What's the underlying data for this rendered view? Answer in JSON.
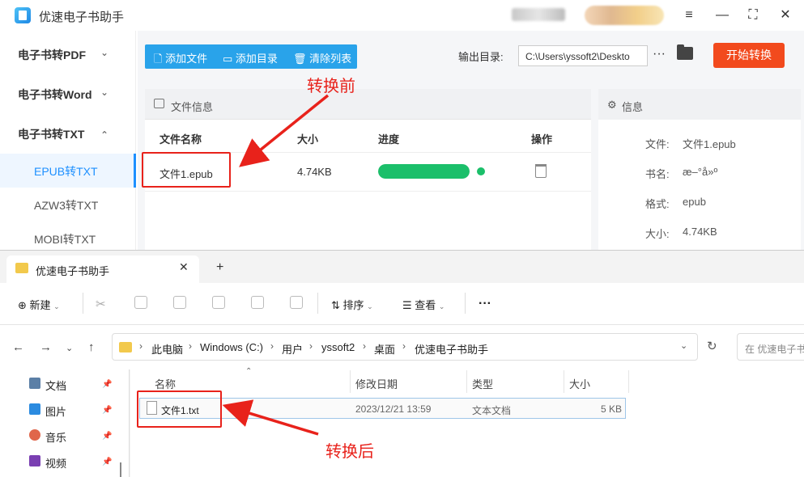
{
  "app": {
    "title": "优速电子书助手",
    "window_controls": [
      "menu-icon",
      "minimize-icon",
      "maximize-icon",
      "close-icon"
    ]
  },
  "sidebar": {
    "groups": [
      {
        "label": "电子书转PDF",
        "chevron": "⌄"
      },
      {
        "label": "电子书转Word",
        "chevron": "⌄"
      },
      {
        "label": "电子书转TXT",
        "chevron": "⌃"
      }
    ],
    "subitems": [
      "EPUB转TXT",
      "AZW3转TXT",
      "MOBI转TXT"
    ],
    "active": "EPUB转TXT"
  },
  "toolbar": {
    "add_file": "添加文件",
    "add_dir": "添加目录",
    "clear_list": "清除列表",
    "output_label": "输出目录:",
    "output_path": "C:\\Users\\yssoft2\\Deskto",
    "more": "···",
    "start": "开始转换"
  },
  "file_panel": {
    "title": "文件信息",
    "headers": [
      "文件名称",
      "大小",
      "进度",
      "操作"
    ],
    "row": {
      "name": "文件1.epub",
      "size": "4.74KB",
      "progress": 1.0
    }
  },
  "info_panel": {
    "title": "信息",
    "fields": [
      {
        "k": "文件:",
        "v": "文件1.epub"
      },
      {
        "k": "书名:",
        "v": "æ–°å»º"
      },
      {
        "k": "格式:",
        "v": "epub"
      },
      {
        "k": "大小:",
        "v": "4.74KB"
      }
    ]
  },
  "annotations": {
    "before": "转换前",
    "after": "转换后",
    "color": "#e8221b"
  },
  "explorer": {
    "tab_title": "优速电子书助手",
    "new_tab": "+",
    "toolbar": {
      "new": "新建",
      "sort": "排序",
      "view": "查看",
      "more": "···"
    },
    "breadcrumb": [
      "此电脑",
      "Windows (C:)",
      "用户",
      "yssoft2",
      "桌面",
      "优速电子书助手"
    ],
    "search_placeholder": "在 优速电子书助手",
    "nav_items": [
      {
        "label": "文档",
        "icon": "document-icon"
      },
      {
        "label": "图片",
        "icon": "picture-icon"
      },
      {
        "label": "音乐",
        "icon": "music-icon"
      },
      {
        "label": "视频",
        "icon": "video-icon"
      }
    ],
    "columns": [
      "名称",
      "修改日期",
      "类型",
      "大小"
    ],
    "file": {
      "name": "文件1.txt",
      "date": "2023/12/21 13:59",
      "type": "文本文档",
      "size": "5 KB"
    }
  }
}
